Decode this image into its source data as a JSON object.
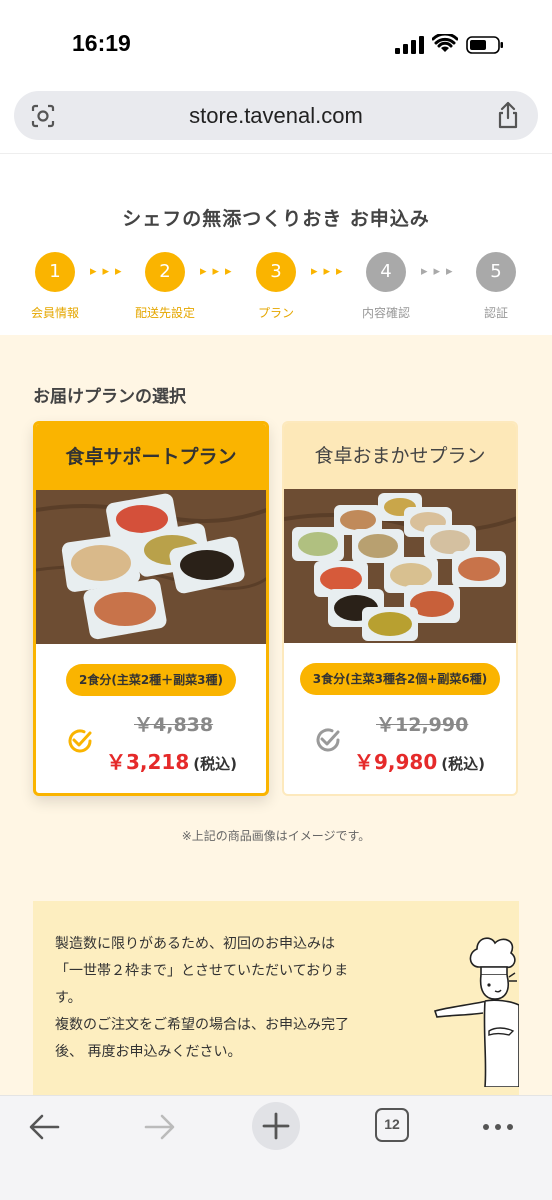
{
  "status": {
    "time": "16:19"
  },
  "browser": {
    "url": "store.tavenal.com",
    "tab_count": "12"
  },
  "page": {
    "title": "シェフの無添つくりおき お申込み"
  },
  "steps": [
    {
      "number": "1",
      "label": "会員情報",
      "state": "done"
    },
    {
      "number": "2",
      "label": "配送先設定",
      "state": "done"
    },
    {
      "number": "3",
      "label": "プラン",
      "state": "done"
    },
    {
      "number": "4",
      "label": "内容確認",
      "state": "todo"
    },
    {
      "number": "5",
      "label": "認証",
      "state": "todo"
    }
  ],
  "section": {
    "title": "お届けプランの選択"
  },
  "plans": [
    {
      "name": "食卓サポートプラン",
      "badge": "2食分(主菜2種＋副菜3種)",
      "old_price": "￥4,838",
      "new_price": "￥3,218",
      "tax_label": "(税込)",
      "selected": true
    },
    {
      "name": "食卓おまかせプラン",
      "badge": "3食分(主菜3種各2個+副菜6種)",
      "old_price": "￥12,990",
      "new_price": "￥9,980",
      "tax_label": "(税込)",
      "selected": false
    }
  ],
  "note": "※上記の商品画像はイメージです。",
  "info": {
    "lines": [
      "製造数に限りがあるため、初回のお申込みは",
      "「一世帯２枠まで」とさせていただいておりま",
      "す。",
      "複数のご注文をご希望の場合は、お申込み完了",
      "後、 再度お申込みください。"
    ]
  },
  "colors": {
    "accent": "#fab400",
    "price_red": "#e52a2a",
    "background": "#fff6e4"
  }
}
